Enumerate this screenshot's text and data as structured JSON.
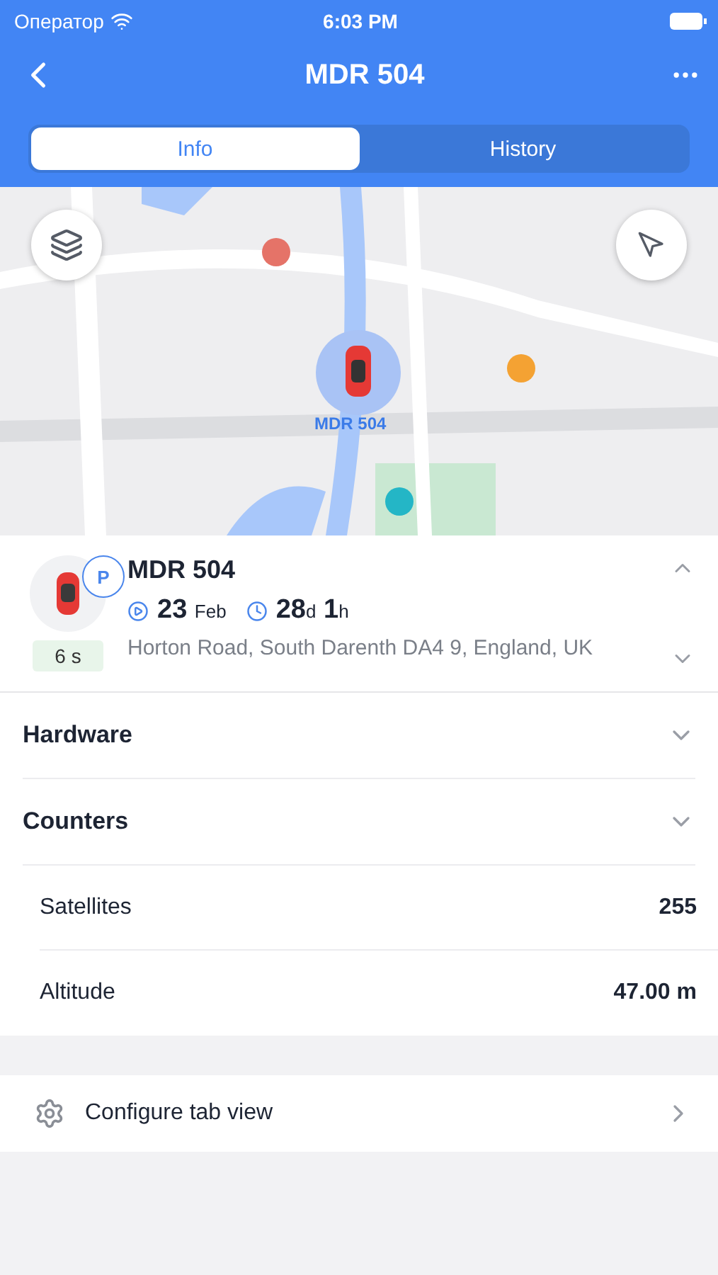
{
  "status_bar": {
    "carrier": "Оператор",
    "time": "6:03 PM"
  },
  "nav": {
    "title": "MDR 504"
  },
  "tabs": [
    {
      "label": "Info",
      "selected": true
    },
    {
      "label": "History",
      "selected": false
    }
  ],
  "map": {
    "kind": "picture",
    "marker_label": "MDR 504"
  },
  "vehicle": {
    "name": "MDR 504",
    "badge": "P",
    "age": "6 s",
    "date": {
      "value": "23",
      "unit": "Feb"
    },
    "duration": [
      {
        "value": "28",
        "unit": "d"
      },
      {
        "value": "1",
        "unit": "h"
      }
    ],
    "address": "Horton Road, South Darenth DA4 9, England, UK",
    "expanded": true
  },
  "sections": [
    {
      "title": "Hardware"
    },
    {
      "title": "Counters",
      "rows": [
        {
          "label": "Satellites",
          "value": "255"
        },
        {
          "label": "Altitude",
          "value": "47.00 m"
        }
      ]
    }
  ],
  "configure": {
    "label": "Configure tab view"
  }
}
